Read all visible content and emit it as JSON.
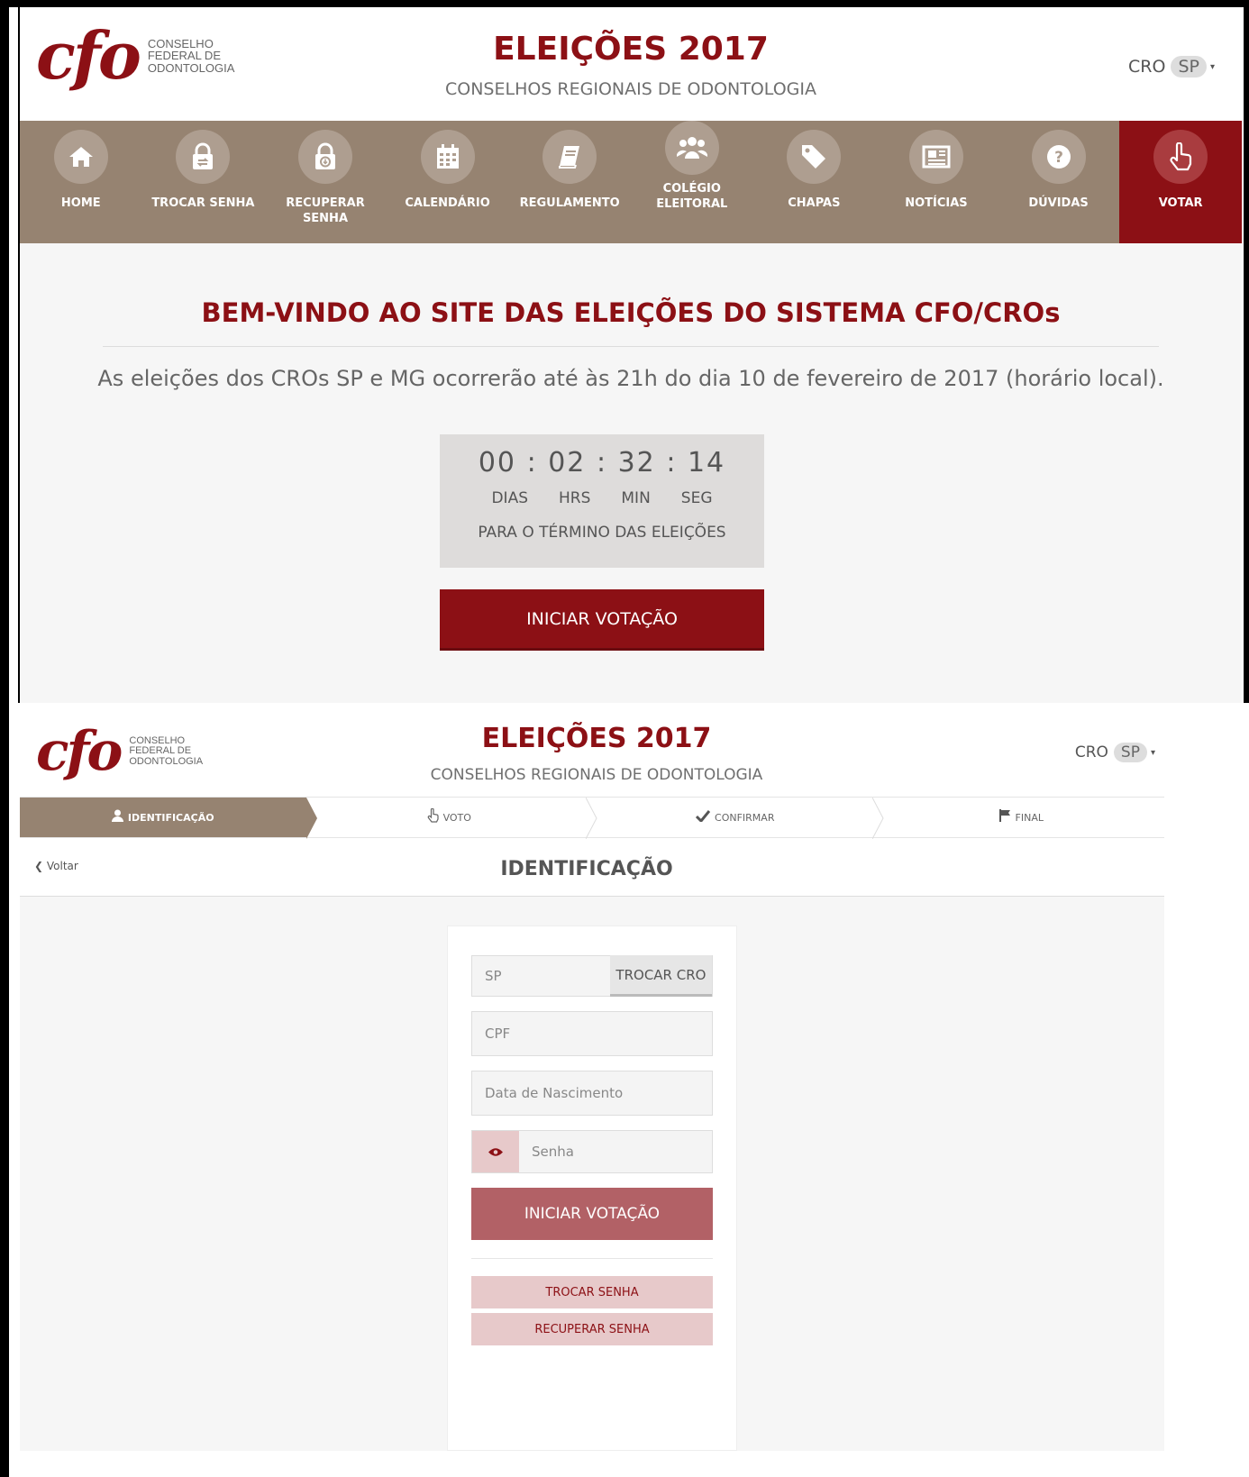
{
  "logo": {
    "mark": "cfo",
    "org_lines": [
      "CONSELHO",
      "FEDERAL DE",
      "ODONTOLOGIA"
    ]
  },
  "header": {
    "title": "ELEIÇÕES 2017",
    "subtitle": "CONSELHOS REGIONAIS DE ODONTOLOGIA",
    "cro_label": "CRO",
    "cro_value": "SP"
  },
  "nav": {
    "items": [
      {
        "label": "HOME",
        "icon": "home-icon"
      },
      {
        "label": "TROCAR SENHA",
        "icon": "lock-swap-icon"
      },
      {
        "label": "RECUPERAR SENHA",
        "icon": "lock-recover-icon"
      },
      {
        "label": "CALENDÁRIO",
        "icon": "calendar-icon"
      },
      {
        "label": "REGULAMENTO",
        "icon": "book-icon"
      },
      {
        "label": "COLÉGIO ELEITORAL",
        "icon": "users-icon"
      },
      {
        "label": "CHAPAS",
        "icon": "tag-icon"
      },
      {
        "label": "NOTÍCIAS",
        "icon": "newspaper-icon"
      },
      {
        "label": "DÚVIDAS",
        "icon": "question-icon"
      },
      {
        "label": "VOTAR",
        "icon": "hand-pointer-icon"
      }
    ]
  },
  "home": {
    "welcome": "BEM-VINDO AO SITE DAS ELEIÇÕES DO SISTEMA CFO/CROs",
    "notice": "As eleições dos CROs SP e MG ocorrerão até às 21h do dia 10 de fevereiro de 2017 (horário local).",
    "countdown": {
      "days": "00",
      "hours": "02",
      "minutes": "32",
      "seconds": "14",
      "units": [
        "DIAS",
        "HRS",
        "MIN",
        "SEG"
      ],
      "caption": "PARA O TÉRMINO DAS ELEIÇÕES"
    },
    "start_button": "INICIAR VOTAÇÃO"
  },
  "steps": [
    {
      "label": "IDENTIFICAÇÃO",
      "icon": "user-icon"
    },
    {
      "label": "VOTO",
      "icon": "hand-pointer-icon"
    },
    {
      "label": "CONFIRMAR",
      "icon": "check-icon"
    },
    {
      "label": "FINAL",
      "icon": "flag-icon"
    }
  ],
  "identification": {
    "back_label": "Voltar",
    "title": "IDENTIFICAÇÃO",
    "cro_value": "SP",
    "swap_cro_label": "TROCAR CRO",
    "cpf_placeholder": "CPF",
    "dob_placeholder": "Data de Nascimento",
    "password_placeholder": "Senha",
    "start_button": "INICIAR VOTAÇÃO",
    "change_password": "TROCAR SENHA",
    "recover_password": "RECUPERAR SENHA"
  },
  "colors": {
    "brand": "#8c1015",
    "nav_bg": "#968371",
    "nav_circle": "#ae9e90",
    "button_soft": "#b26166",
    "button_light": "#e7c9ca"
  }
}
